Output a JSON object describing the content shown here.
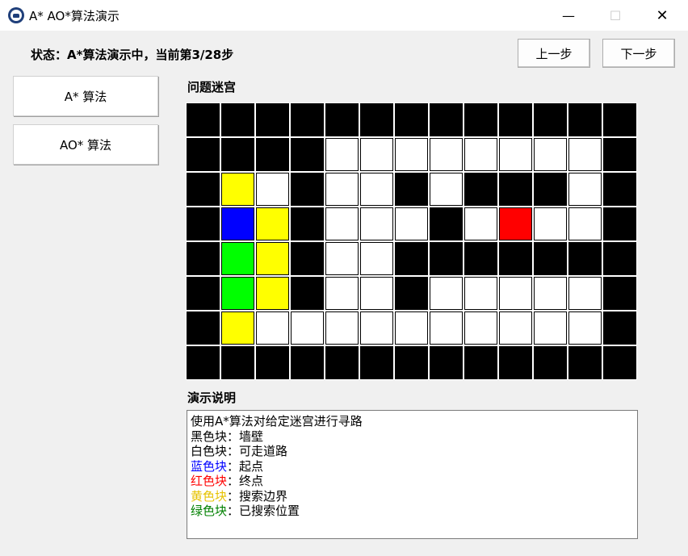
{
  "window": {
    "title": "A* AO*算法演示",
    "controls": {
      "minimize": "—",
      "maximize": "☐",
      "close": "✕"
    }
  },
  "status": "状态：A*算法演示中，当前第3/28步",
  "nav": {
    "prev_label": "上一步",
    "next_label": "下一步"
  },
  "algorithms": {
    "astar_label": "A* 算法",
    "aostar_label": "AO* 算法"
  },
  "maze": {
    "title": "问题迷宫",
    "rows": 8,
    "cols": 13,
    "legend_codes": {
      "W": "wall",
      "O": "open",
      "S": "start",
      "E": "end",
      "F": "frontier",
      "V": "visited"
    },
    "colors": {
      "W": "#000000",
      "O": "#ffffff",
      "S": "#0000ff",
      "E": "#ff0000",
      "F": "#ffff00",
      "V": "#00ff00"
    },
    "grid": [
      "WWWWWWWWWWWWW",
      "WWWWOOOOOOOOW",
      "WFOWOOWOWWWOW",
      "WSFWOOOWOEOOW",
      "WVFWOOWWWWWWW",
      "WVFWOOWOOOOOW",
      "WFOOOOOOOOOOW",
      "WWWWWWWWWWWWW"
    ]
  },
  "description": {
    "title": "演示说明",
    "intro": "使用A*算法对给定迷宫进行寻路",
    "legend": [
      {
        "colored": "黑色块",
        "rest": "：墙壁",
        "color": "#000000"
      },
      {
        "colored": "白色块",
        "rest": "：可走道路",
        "color": "#000000"
      },
      {
        "colored": "蓝色块",
        "rest": "：起点",
        "color": "#0000ff"
      },
      {
        "colored": "红色块",
        "rest": "：终点",
        "color": "#ff0000"
      },
      {
        "colored": "黄色块",
        "rest": "：搜索边界",
        "color": "#e6c200"
      },
      {
        "colored": "绿色块",
        "rest": "：已搜索位置",
        "color": "#008000"
      }
    ]
  }
}
